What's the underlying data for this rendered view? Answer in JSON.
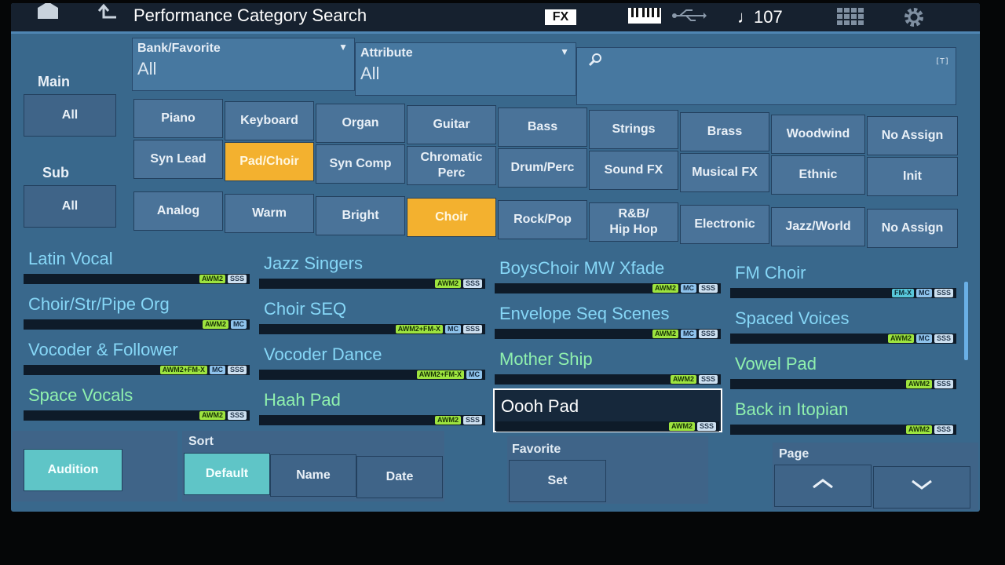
{
  "header": {
    "title": "Performance Category Search",
    "fx_badge": "FX",
    "tempo": "107",
    "icons": [
      "home-icon",
      "back-icon",
      "keyboard-icon",
      "usb-icon",
      "note-icon",
      "grid-icon",
      "gear-icon"
    ]
  },
  "filters": {
    "bank_label": "Bank/Favorite",
    "bank_value": "All",
    "attribute_label": "Attribute",
    "attribute_value": "All",
    "search_placeholder": ""
  },
  "main": {
    "label": "Main",
    "all_label": "All",
    "row1": [
      "Piano",
      "Keyboard",
      "Organ",
      "Guitar",
      "Bass",
      "Strings",
      "Brass",
      "Woodwind",
      "No Assign"
    ],
    "row2": [
      "Syn Lead",
      "Pad/Choir",
      "Syn Comp",
      "Chromatic\nPerc",
      "Drum/Perc",
      "Sound FX",
      "Musical FX",
      "Ethnic",
      "Init"
    ],
    "selected": "Pad/Choir"
  },
  "sub": {
    "label": "Sub",
    "all_label": "All",
    "items": [
      "Analog",
      "Warm",
      "Bright",
      "Choir",
      "Rock/Pop",
      "R&B/\nHip Hop",
      "Electronic",
      "Jazz/World",
      "No Assign"
    ],
    "selected": "Choir"
  },
  "results": [
    {
      "name": "Latin Vocal",
      "tags": [
        "AWM2",
        "SSS"
      ]
    },
    {
      "name": "Choir/Str/Pipe Org",
      "tags": [
        "AWM2",
        "MC"
      ]
    },
    {
      "name": "Vocoder & Follower",
      "tags": [
        "AWM2+FM-X",
        "MC",
        "SSS"
      ]
    },
    {
      "name": "Space Vocals",
      "tags": [
        "AWM2",
        "SSS"
      ]
    },
    {
      "name": "Jazz Singers",
      "tags": [
        "AWM2",
        "SSS"
      ]
    },
    {
      "name": "Choir SEQ",
      "tags": [
        "AWM2+FM-X",
        "MC",
        "SSS"
      ]
    },
    {
      "name": "Vocoder Dance",
      "tags": [
        "AWM2+FM-X",
        "MC"
      ]
    },
    {
      "name": "Haah Pad",
      "tags": [
        "AWM2",
        "SSS"
      ]
    },
    {
      "name": "BoysChoir MW Xfade",
      "tags": [
        "AWM2",
        "MC",
        "SSS"
      ]
    },
    {
      "name": "Envelope Seq Scenes",
      "tags": [
        "AWM2",
        "MC",
        "SSS"
      ]
    },
    {
      "name": "Mother Ship",
      "tags": [
        "AWM2",
        "SSS"
      ]
    },
    {
      "name": "Oooh Pad",
      "tags": [
        "AWM2",
        "SSS"
      ]
    },
    {
      "name": "FM Choir",
      "tags": [
        "FM-X",
        "MC",
        "SSS"
      ]
    },
    {
      "name": "Spaced Voices",
      "tags": [
        "AWM2",
        "MC",
        "SSS"
      ]
    },
    {
      "name": "Vowel Pad",
      "tags": [
        "AWM2",
        "SSS"
      ]
    },
    {
      "name": "Back in Itopian",
      "tags": [
        "AWM2",
        "SSS"
      ]
    }
  ],
  "selected_result": "Oooh Pad",
  "footer": {
    "audition": "Audition",
    "sort_label": "Sort",
    "sort_default": "Default",
    "sort_name": "Name",
    "sort_date": "Date",
    "favorite_label": "Favorite",
    "favorite_set": "Set",
    "page_label": "Page"
  },
  "colors": {
    "accent": "#f3b12f",
    "teal": "#5fc5c7",
    "panel": "#39688c",
    "name_blue": "#86d7f7",
    "name_green": "#8ff0ae"
  }
}
